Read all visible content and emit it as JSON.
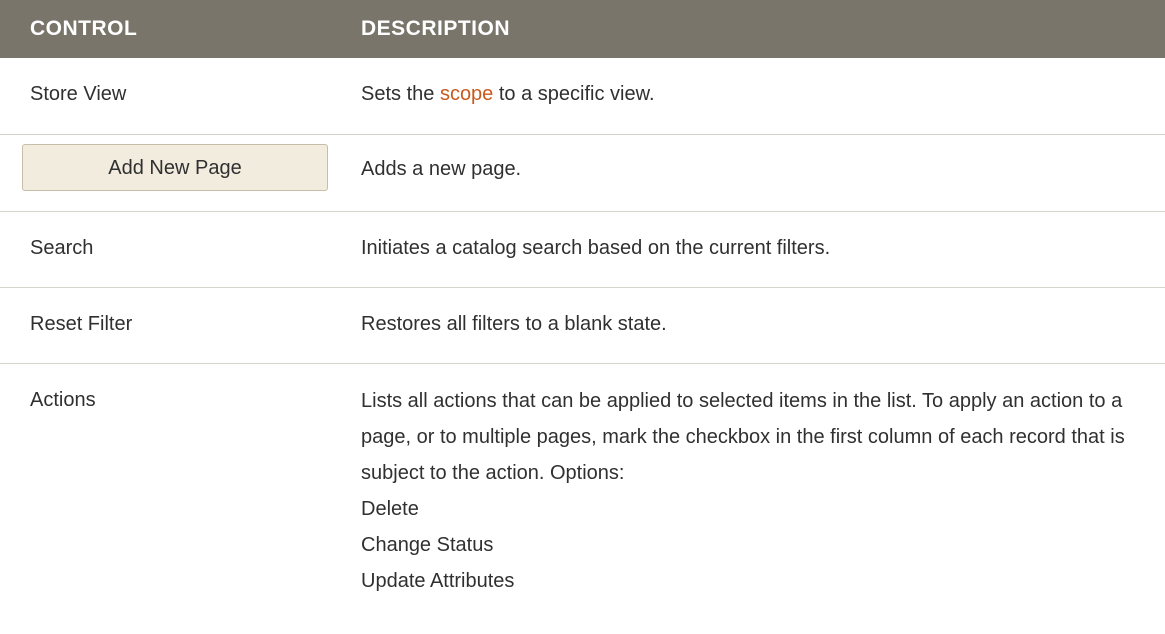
{
  "table": {
    "headers": {
      "control": "CONTROL",
      "description": "DESCRIPTION"
    },
    "rows": [
      {
        "control": "Store View",
        "desc_prefix": "Sets the ",
        "desc_link": "scope",
        "desc_suffix": " to a specific view."
      },
      {
        "control_button": "Add New Page",
        "description": "Adds a new page."
      },
      {
        "control": "Search",
        "description": "Initiates a catalog search based on the current filters."
      },
      {
        "control": "Reset Filter",
        "description": "Restores all filters to a blank state."
      },
      {
        "control": "Actions",
        "description": "Lists all actions that can be applied to selected items in the list. To apply an action to a page, or to multiple pages, mark the checkbox in the first column of each record that is subject to the action. Options:",
        "options": [
          "Delete",
          "Change Status",
          "Update Attributes"
        ]
      }
    ]
  },
  "colors": {
    "header_bg": "#7a756b",
    "link": "#c85a1d",
    "button_bg": "#f2ecde"
  }
}
